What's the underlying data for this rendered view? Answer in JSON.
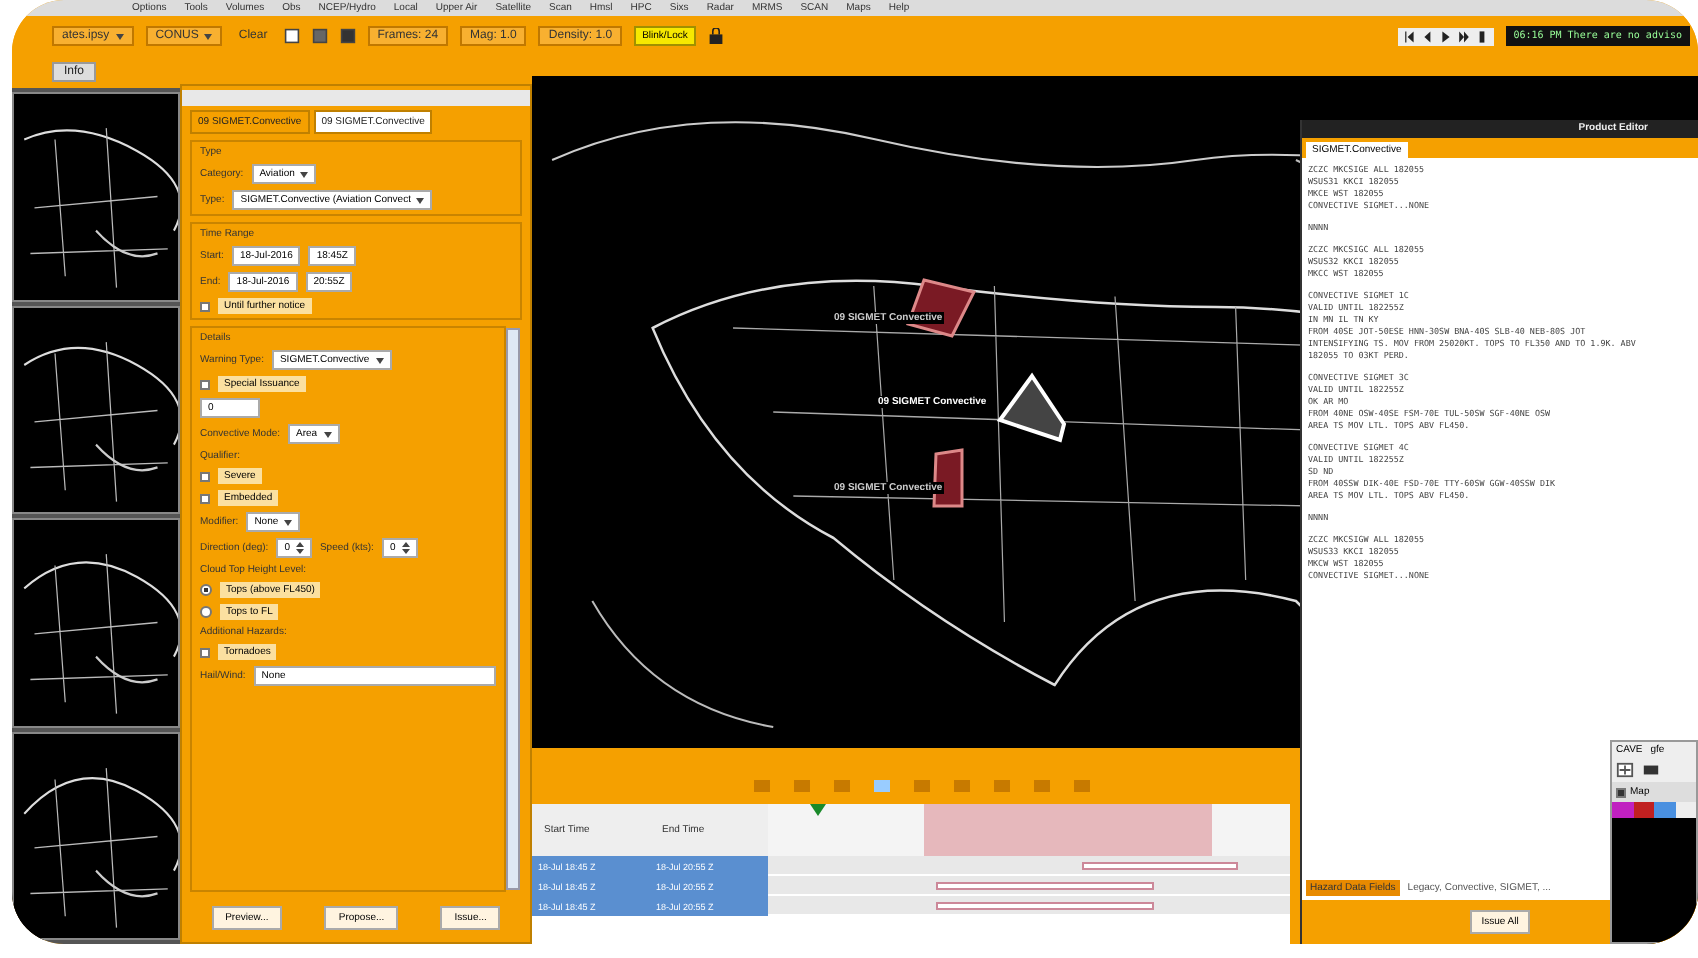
{
  "menu_bar": [
    "Options",
    "Tools",
    "Volumes",
    "Obs",
    "NCEP/Hydro",
    "Local",
    "Upper Air",
    "Satellite",
    "Scan",
    "Hmsl",
    "HPC",
    "Sixs",
    "Radar",
    "MRMS",
    "SCAN",
    "Maps",
    "Help"
  ],
  "toolbar": {
    "combos": [
      {
        "value": "ates.ipsy"
      },
      {
        "value": "CONUS"
      }
    ],
    "clear": "Clear",
    "frames": "Frames: 24",
    "mag": "Mag: 1.0",
    "density": "Density: 1.0",
    "highlight_button": "Blink/Lock",
    "status_message": "06:16 PM There are no adviso"
  },
  "editor_tab": {
    "label": "Info"
  },
  "hazard_dialog": {
    "tabs": [
      {
        "label": "09 SIGMET.Convective",
        "selected": false
      },
      {
        "label": "09 SIGMET.Convective",
        "selected": true
      }
    ],
    "sections": [
      {
        "title": "Type",
        "rows": [
          {
            "kind": "combo",
            "label": "Category:",
            "value": "Aviation"
          },
          {
            "kind": "combo",
            "label": "Type:",
            "value": "SIGMET.Convective (Aviation Convect"
          }
        ]
      },
      {
        "title": "Time Range",
        "rows": [
          {
            "kind": "datetime",
            "label": "Start:",
            "date": "18-Jul-2016",
            "time": "18:45Z"
          },
          {
            "kind": "datetime",
            "label": "End:",
            "date": "18-Jul-2016",
            "time": "20:55Z"
          },
          {
            "kind": "checkbox",
            "label": "Until further notice",
            "checked": false
          }
        ]
      },
      {
        "title": "Details",
        "rows": [
          {
            "kind": "combo",
            "label": "Warning Type:",
            "value": "SIGMET.Convective"
          },
          {
            "kind": "checkbox",
            "label": "Special Issuance",
            "checked": false
          },
          {
            "kind": "field",
            "value": "0"
          },
          {
            "kind": "combo",
            "label": "Convective Mode:",
            "value": "Area"
          },
          {
            "kind": "heading",
            "label": "Qualifier:"
          },
          {
            "kind": "checkbox",
            "label": "Severe",
            "checked": false
          },
          {
            "kind": "checkbox",
            "label": "Embedded",
            "checked": false
          },
          {
            "kind": "combo",
            "label": "Modifier:",
            "value": "None"
          },
          {
            "kind": "pair",
            "label": "Direction (deg):",
            "value": "0",
            "label2": "Speed (kts):",
            "value2": "0"
          },
          {
            "kind": "heading",
            "label": "Cloud Top Height Level:"
          },
          {
            "kind": "radio",
            "label": "Tops (above FL450)",
            "selected": true
          },
          {
            "kind": "radio",
            "label": "Tops to FL",
            "selected": false
          },
          {
            "kind": "heading",
            "label": "Additional Hazards:"
          },
          {
            "kind": "checkbox",
            "label": "Tornadoes",
            "checked": false
          },
          {
            "kind": "wide",
            "label": "Hail/Wind:",
            "value": "None"
          }
        ]
      }
    ],
    "buttons": [
      "Preview...",
      "Propose...",
      "Issue..."
    ]
  },
  "map": {
    "labels": [
      {
        "text": "09 SIGMET Convective",
        "selected": false
      },
      {
        "text": "09 SIGMET Convective",
        "selected": true
      },
      {
        "text": "09 SIGMET Convective",
        "selected": false
      }
    ]
  },
  "timeline": {
    "columns": [
      "Start Time",
      "End Time"
    ],
    "rows": [
      {
        "start": "18-Jul 18:45 Z",
        "end": "18-Jul 20:55 Z",
        "selected": true
      },
      {
        "start": "18-Jul 18:45 Z",
        "end": "18-Jul 20:55 Z",
        "selected": true
      },
      {
        "start": "18-Jul 18:45 Z",
        "end": "18-Jul 20:55 Z",
        "selected": true
      }
    ]
  },
  "product_editor": {
    "title": "Product Editor",
    "tab": "SIGMET.Convective",
    "blocks": [
      [
        "ZCZC MKCSIGE ALL 182055",
        "WSUS31 KKCI 182055",
        "MKCE WST 182055",
        "CONVECTIVE SIGMET...NONE"
      ],
      [
        "NNNN"
      ],
      [
        "ZCZC MKCSIGC ALL 182055",
        "WSUS32 KKCI 182055",
        "MKCC WST 182055"
      ],
      [
        "CONVECTIVE SIGMET 1C",
        "VALID UNTIL 182255Z",
        "IN MN IL TN KY",
        "FROM 40SE JOT-50ESE HNN-30SW BNA-40S SLB-40 NEB-80S JOT",
        "INTENSIFYING TS. MOV FROM 25020KT. TOPS TO FL350 AND TO 1.9K. ABV",
        "182055 TO 03KT PERD."
      ],
      [
        "CONVECTIVE SIGMET 3C",
        "VALID UNTIL 182255Z",
        "OK AR MO",
        "FROM 40NE OSW-40SE FSM-70E TUL-50SW SGF-40NE OSW",
        "AREA TS MOV LTL. TOPS ABV FL450."
      ],
      [
        "CONVECTIVE SIGMET 4C",
        "VALID UNTIL 182255Z",
        "SD ND",
        "FROM 40SSW DIK-40E FSD-70E TTY-60SW GGW-40SSW DIK",
        "AREA TS MOV LTL. TOPS ABV FL450."
      ],
      [
        "NNNN"
      ],
      [
        "ZCZC MKCSIGW ALL 182055",
        "WSUS33 KKCI 182055",
        "MKCW WST 182055",
        "CONVECTIVE SIGMET...NONE"
      ]
    ],
    "field_label": "Hazard Data Fields",
    "field_value": "Legacy, Convective, SIGMET, ...",
    "button": "Issue All"
  },
  "mini_window": {
    "labels": [
      "CAVE",
      "gfe"
    ],
    "layer": {
      "label": "Map",
      "checked": true
    }
  }
}
